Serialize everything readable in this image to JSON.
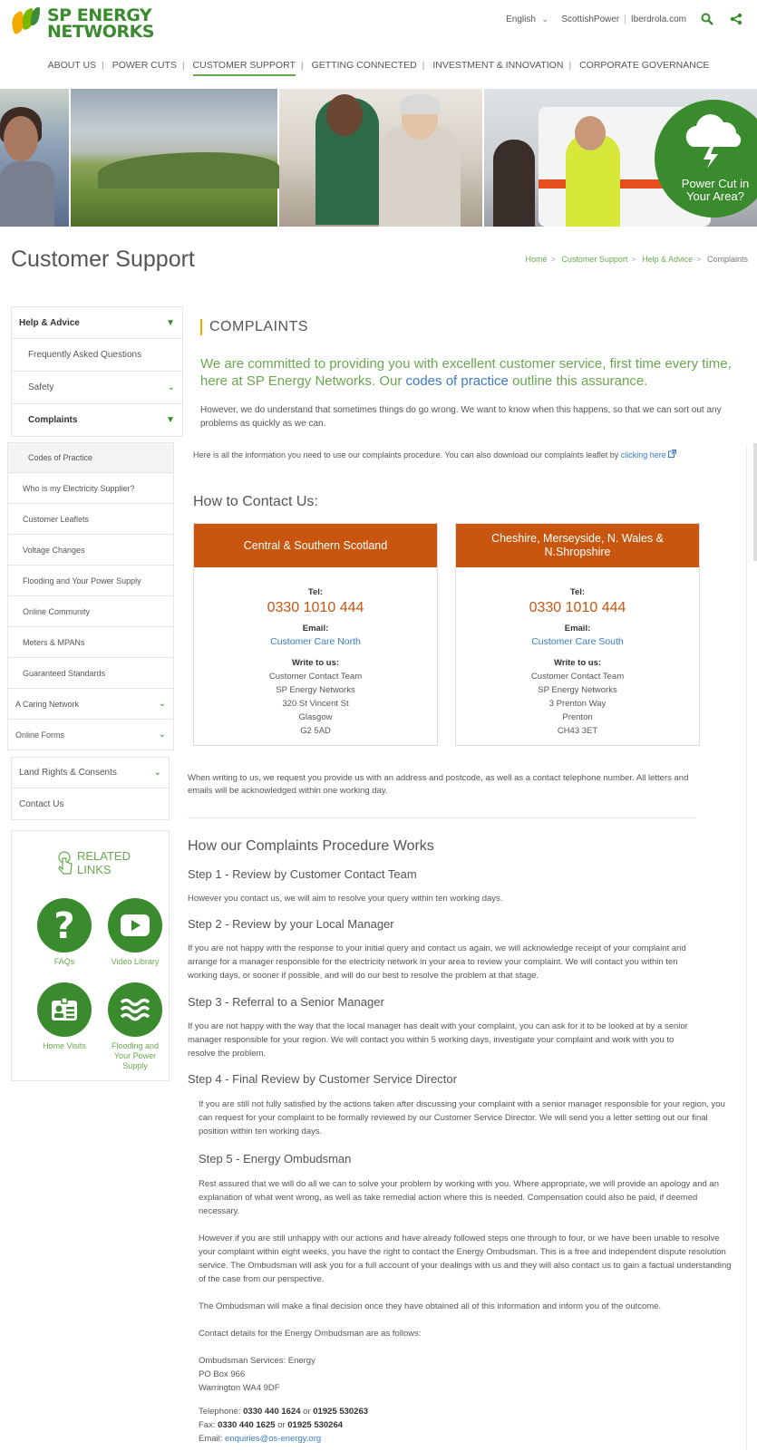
{
  "header": {
    "logo_line1": "SP ENERGY",
    "logo_line2": "NETWORKS",
    "language": "English",
    "link1": "ScottishPower",
    "link2": "Iberdrola.com"
  },
  "nav": [
    "ABOUT US",
    "POWER CUTS",
    "CUSTOMER SUPPORT",
    "GETTING CONNECTED",
    "INVESTMENT & INNOVATION",
    "CORPORATE GOVERNANCE"
  ],
  "banner": {
    "power_cut_text": "Power Cut in Your Area?"
  },
  "page_title": "Customer Support",
  "breadcrumb": [
    "Home",
    "Customer Support",
    "Help & Advice",
    "Complaints"
  ],
  "sidebar": {
    "top": [
      "Help & Advice",
      "Frequently Asked Questions",
      "Safety",
      "Complaints"
    ],
    "sub": [
      "Codes of Practice",
      "Who is my Electricity Supplier?",
      "Customer Leaflets",
      "Voltage Changes",
      "Flooding and Your Power Supply",
      "Online Community",
      "Meters & MPANs",
      "Guaranteed Standards",
      "A Caring Network",
      "Online Forms"
    ],
    "lower": [
      "Land Rights & Consents",
      "Contact Us"
    ]
  },
  "related": {
    "heading": "RELATED LINKS",
    "links": [
      "FAQs",
      "Video Library",
      "Home Visits",
      "Flooding and Your Power Supply"
    ]
  },
  "content": {
    "heading": "COMPLAINTS",
    "lead_pre": "We are committed to providing you with excellent customer service, first time every time, here at SP Energy Networks. Our ",
    "lead_link": "codes of practice",
    "lead_post": " outline this assurance.",
    "p1": "However, we do understand that sometimes things do go wrong. We want to know when this happens, so that we can sort out any problems as quickly as we can.",
    "p2_pre": "Here is all the information you need to use our complaints procedure.  You can also download our complaints leaflet by ",
    "p2_link": "clicking here",
    "howto": "How to Contact Us:",
    "cards": [
      {
        "title": "Central & Southern Scotland",
        "tel_label": "Tel:",
        "tel": "0330 1010 444",
        "email_label": "Email:",
        "email": "Customer Care North",
        "write_label": "Write to us:",
        "address": [
          "Customer Contact Team",
          "SP Energy Networks",
          "320 St Vincent St",
          "Glasgow",
          "G2 5AD"
        ]
      },
      {
        "title": "Cheshire, Merseyside, N. Wales & N.Shropshire",
        "tel_label": "Tel:",
        "tel": "0330 1010 444",
        "email_label": "Email:",
        "email": "Customer Care South",
        "write_label": "Write to us:",
        "address": [
          "Customer Contact Team",
          "SP Energy Networks",
          "3 Prenton Way",
          "Prenton",
          "CH43 3ET"
        ]
      }
    ],
    "p3": "When writing to us, we request you provide us with an address and postcode, as well as a contact telephone number. All letters and emails will be acknowledged within one working day.",
    "procedure_heading": "How our Complaints Procedure Works",
    "steps": [
      {
        "title": "Step 1 - Review by Customer Contact Team",
        "text": "However you contact us, we will aim to resolve your query within ten working days."
      },
      {
        "title": "Step 2 - Review by your Local Manager",
        "text": "If you are not happy with the response to your initial query and contact us again, we will acknowledge receipt of your complaint and arrange for a manager responsible for the electricity network in your area to review your complaint. We will contact you within ten working days, or sooner if possible, and will do our best to resolve the problem at that stage."
      },
      {
        "title": "Step 3 - Referral to a Senior Manager",
        "text": "If you are not happy with the way that the local manager has dealt with your complaint, you can ask for it to be looked at by a senior manager responsible for your region.  We will contact you within 5 working days, investigate your complaint and work with you to resolve the problem."
      },
      {
        "title": "Step 4 - Final Review by Customer Service Director",
        "text": "If you are still not fully satisfied by the actions taken after discussing your complaint with a senior manager responsible for your region, you can request for your complaint to be formally reviewed by our Customer Service Director. We will send you a letter setting out our final position within ten working days."
      },
      {
        "title": "Step 5 - Energy Ombudsman",
        "text": "Rest assured that we will do all we can to solve your problem by working with you. Where appropriate, we will provide an apology and an explanation of what went wrong, as well as take remedial action where this is needed. Compensation could also be paid, if deemed necessary."
      }
    ],
    "ombud_p1": "However if you are still unhappy with our actions and have already followed steps one through to four, or we have been unable to resolve your complaint within eight weeks, you have the right to contact the Energy Ombudsman. This is a free and independent dispute resolution service. The Ombudsman will ask you for a full account of your dealings with us and they will also contact us to gain a factual understanding of the case from our perspective.",
    "ombud_p2": "The Ombudsman will make a final decision once they have obtained all of this information and inform you of the outcome.",
    "ombud_p3": "Contact details for the Energy Ombudsman are as follows:",
    "ombud_address": [
      "Ombudsman Services: Energy",
      "PO Box 966",
      "Warrington WA4 9DF"
    ],
    "telephone_label": "Telephone: ",
    "telephone_1": "0330 440 1624",
    "or": " or ",
    "telephone_2": "01925 530263",
    "fax_label": "Fax: ",
    "fax_1": "0330 440 1625",
    "fax_2": "01925 530264",
    "email_label": "Email: ",
    "email": "enquiries@os-energy.org"
  },
  "colors": {
    "brand_green": "#3a8b2e",
    "accent_orange": "#c8560f",
    "link_blue": "#3a7bc8",
    "light_green": "#6aa84f"
  }
}
